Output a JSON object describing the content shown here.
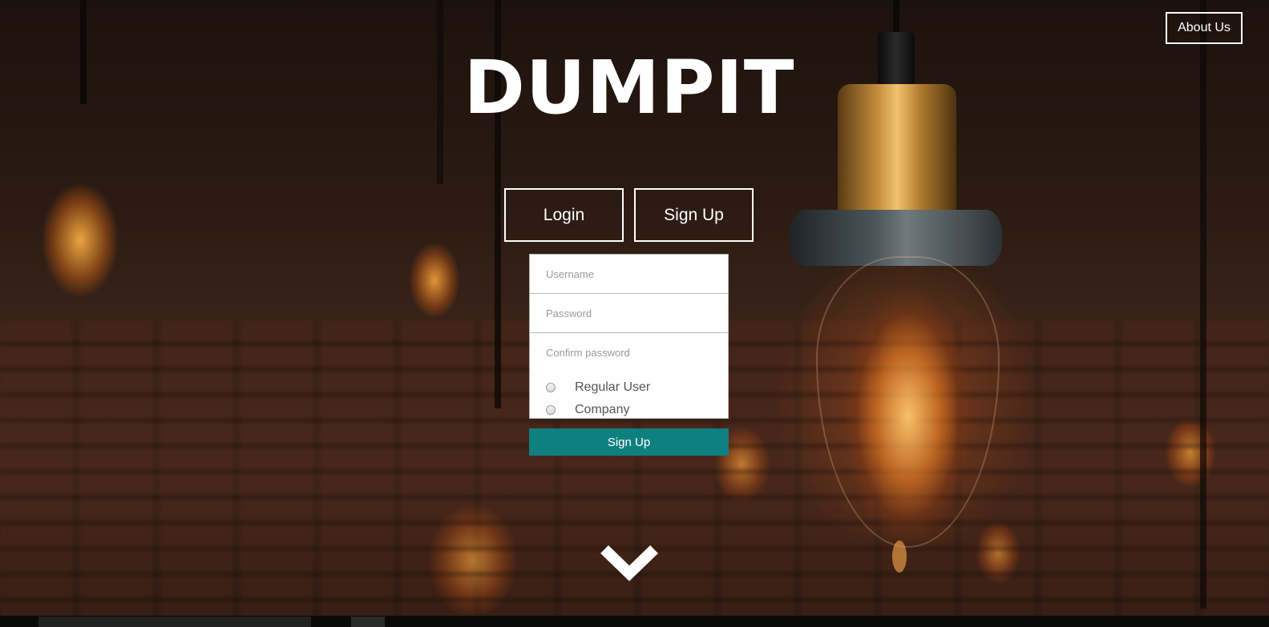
{
  "header": {
    "about_label": "About Us"
  },
  "brand": {
    "title": "DUMPIT"
  },
  "tabs": [
    {
      "label": "Login"
    },
    {
      "label": "Sign Up"
    }
  ],
  "signup_form": {
    "username": {
      "placeholder": "Username",
      "value": ""
    },
    "password": {
      "placeholder": "Password",
      "value": ""
    },
    "confirm_password": {
      "placeholder": "Confirm password",
      "value": ""
    },
    "account_types": [
      {
        "label": "Regular User",
        "selected": false
      },
      {
        "label": "Company",
        "selected": false
      }
    ],
    "submit_label": "Sign Up"
  },
  "scroll_indicator": {
    "icon": "chevron-down-icon"
  },
  "colors": {
    "submit_button": "#0f8080",
    "text_light": "#ffffff",
    "field_border": "#b8b8b8"
  }
}
